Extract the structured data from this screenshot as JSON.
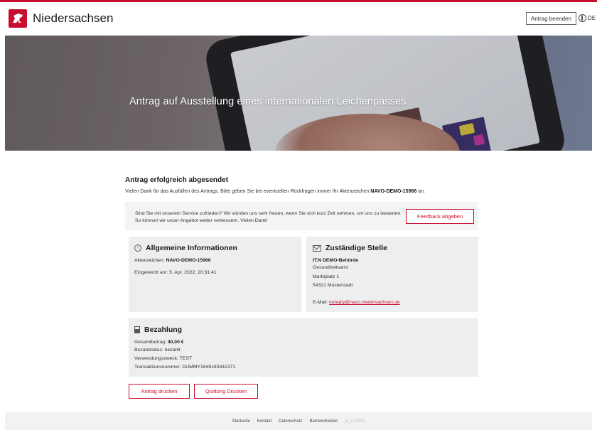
{
  "brand": {
    "name": "Niedersachsen"
  },
  "header": {
    "end_button": "Antrag beenden",
    "language": "DE"
  },
  "hero": {
    "title": "Antrag auf Ausstellung eines internationalen Leichenpasses"
  },
  "confirmation": {
    "title": "Antrag erfolgreich abgesendet",
    "text_before": "Vielen Dank für das Ausfüllen des Antrags. Bitte geben Sie bei eventuellen Rückfragen immer Ihr Aktenzeichen ",
    "reference": "NAVO-DEMO-15966",
    "text_after": " an."
  },
  "feedback": {
    "text": "Sind Sie mit unserem Service zufrieden? Wir würden uns sehr freuen, wenn Sie sich kurz Zeit nehmen, um uns zu bewerten. So können wir unser Angebot weiter verbessern. Vielen Dank!",
    "button": "Feedback abgeben"
  },
  "general_info": {
    "title": "Allgemeine Informationen",
    "ref_label": "Aktenzeichen: ",
    "ref_value": "NAVO-DEMO-15966",
    "submitted": "Eingereicht am: 5. Apr. 2022, 20:31:41"
  },
  "authority": {
    "title": "Zuständige Stelle",
    "name": "IT.N DEMO-Behörde",
    "dept": "Gesundheitsamt",
    "street": "Marktplatz 1",
    "city": "54321 Musterstadt",
    "email_label": "E-Mail: ",
    "email": "noreply@navo.niedersachsen.de"
  },
  "payment": {
    "title": "Bezahlung",
    "total_label": "Gesamtbetrag: ",
    "total_value": "40,00 €",
    "status": "Bezahlstatus: bezahlt",
    "purpose": "Verwendungszweck: TEST",
    "transaction": "Transaktionsnummer: DUMMY1649183441371"
  },
  "actions": {
    "print_application": "Antrag drucken",
    "print_receipt": "Quittung Drucken"
  },
  "footer": {
    "links": [
      "Startseite",
      "Kontakt",
      "Datenschutz",
      "Barrierefreiheit"
    ],
    "version": "(v_1.1091)"
  },
  "colors": {
    "accent": "#c8102e",
    "card_bg": "#eceeef"
  }
}
